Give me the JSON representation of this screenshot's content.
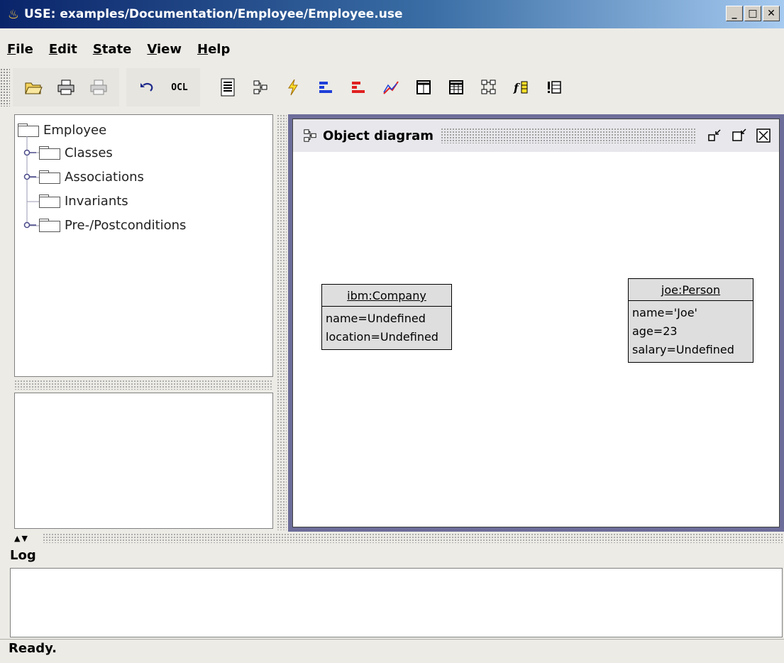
{
  "window": {
    "title": "USE: examples/Documentation/Employee/Employee.use"
  },
  "menu": [
    {
      "label": "File",
      "mnemonic": "F",
      "rest": "ile"
    },
    {
      "label": "Edit",
      "mnemonic": "E",
      "rest": "dit"
    },
    {
      "label": "State",
      "mnemonic": "S",
      "rest": "tate"
    },
    {
      "label": "View",
      "mnemonic": "V",
      "rest": "iew"
    },
    {
      "label": "Help",
      "mnemonic": "H",
      "rest": "elp"
    }
  ],
  "toolbar": {
    "ocl_label": "OCL",
    "icons": [
      "open-folder-icon",
      "print-icon",
      "print-disabled-icon",
      "undo-icon",
      "ocl-icon",
      "class-info-icon",
      "object-diagram-icon",
      "lightning-icon",
      "blue-bars-icon",
      "red-bars-icon",
      "line-chart-icon",
      "class-invariant-icon",
      "object-table-icon",
      "class-diagram-icon",
      "function-icon",
      "invariant-list-icon"
    ]
  },
  "tree": {
    "root": "Employee",
    "children": [
      "Classes",
      "Associations",
      "Invariants",
      "Pre-/Postconditions"
    ]
  },
  "diagram_window": {
    "title": "Object diagram",
    "objects": [
      {
        "name": "ibm:Company",
        "attributes": [
          "name=Undefined",
          "location=Undefined"
        ]
      },
      {
        "name": "joe:Person",
        "attributes": [
          "name='Joe'",
          "age=23",
          "salary=Undefined"
        ]
      }
    ]
  },
  "log": {
    "label": "Log"
  },
  "status": {
    "text": "Ready."
  },
  "colors": {
    "title_gradient_start": "#0a246a",
    "desktop": "#6d6d9a",
    "object_fill": "#dedede"
  }
}
